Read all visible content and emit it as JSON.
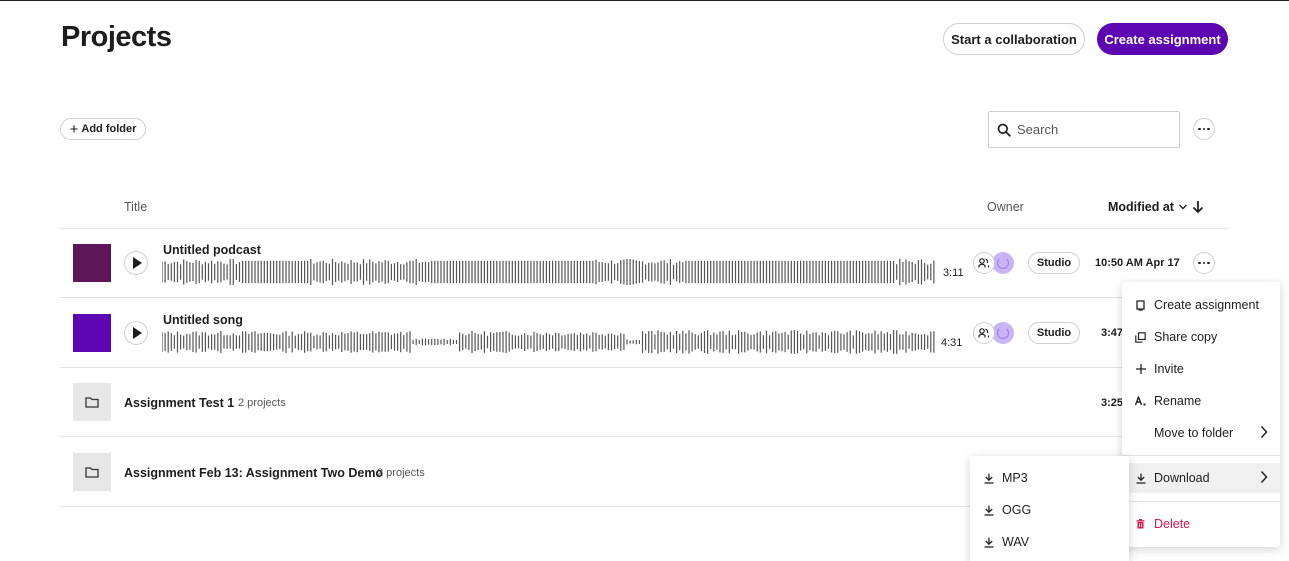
{
  "header": {
    "title": "Projects",
    "collab_label": "Start a collaboration",
    "create_label": "Create assignment"
  },
  "toolbar": {
    "add_folder_label": "Add folder",
    "search_placeholder": "Search"
  },
  "columns": {
    "title": "Title",
    "owner": "Owner",
    "modified": "Modified at"
  },
  "rows": [
    {
      "title": "Untitled podcast",
      "duration": "3:11",
      "badge": "Studio",
      "modified": "10:50 AM Apr 17",
      "thumb_color": "#5d1657"
    },
    {
      "title": "Untitled song",
      "duration": "4:31",
      "badge": "Studio",
      "modified": "3:47",
      "thumb_color": "#5b06b0"
    }
  ],
  "folders": [
    {
      "name": "Assignment Test 1",
      "count": "2 projects",
      "modified": "3:25"
    },
    {
      "name": "Assignment Feb 13: Assignment Two Demo",
      "count": "2 projects"
    }
  ],
  "context_menu": {
    "items": [
      {
        "label": "Create assignment",
        "icon": "assignment-icon"
      },
      {
        "label": "Share copy",
        "icon": "copy-icon"
      },
      {
        "label": "Invite",
        "icon": "plus-icon"
      },
      {
        "label": "Rename",
        "icon": "rename-icon"
      },
      {
        "label": "Move to folder",
        "icon": ""
      },
      {
        "label": "Download",
        "icon": "download-icon"
      },
      {
        "label": "Delete",
        "icon": "trash-icon"
      }
    ]
  },
  "download_menu": {
    "items": [
      {
        "label": "MP3",
        "icon": "download-icon"
      },
      {
        "label": "OGG",
        "icon": "download-icon"
      },
      {
        "label": "WAV",
        "icon": "download-icon"
      }
    ]
  },
  "colors": {
    "primary": "#5b06b0",
    "danger": "#d8164f"
  }
}
